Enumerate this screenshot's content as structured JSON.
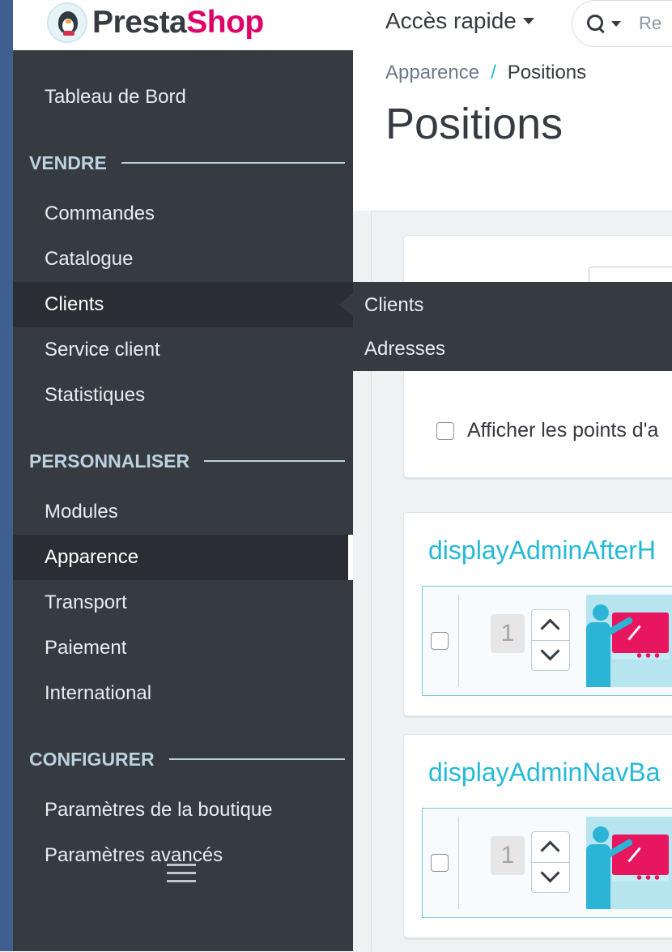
{
  "header": {
    "logo": {
      "part1": "Presta",
      "part2": "Shop"
    },
    "quick_access": "Accès rapide",
    "search_placeholder": "Re"
  },
  "sidebar": {
    "dashboard": "Tableau de Bord",
    "sections": [
      {
        "title": "VENDRE",
        "items": [
          "Commandes",
          "Catalogue",
          "Clients",
          "Service client",
          "Statistiques"
        ]
      },
      {
        "title": "PERSONNALISER",
        "items": [
          "Modules",
          "Apparence",
          "Transport",
          "Paiement",
          "International"
        ]
      },
      {
        "title": "CONFIGURER",
        "items": [
          "Paramètres de la boutique",
          "Paramètres avancés"
        ]
      }
    ]
  },
  "flyout": {
    "items": [
      "Clients",
      "Adresses"
    ]
  },
  "breadcrumb": {
    "parent": "Apparence",
    "separator": "/",
    "current": "Positions"
  },
  "page_title": "Positions",
  "filters": {
    "show_points_label": "Afficher les points d'a"
  },
  "hooks": [
    {
      "title": "displayAdminAfterH",
      "position": "1"
    },
    {
      "title": "displayAdminNavBa",
      "position": "1"
    }
  ],
  "colors": {
    "sidebar_bg": "#363a41",
    "accent_blue": "#25b9d7",
    "brand_pink": "#df0067"
  }
}
